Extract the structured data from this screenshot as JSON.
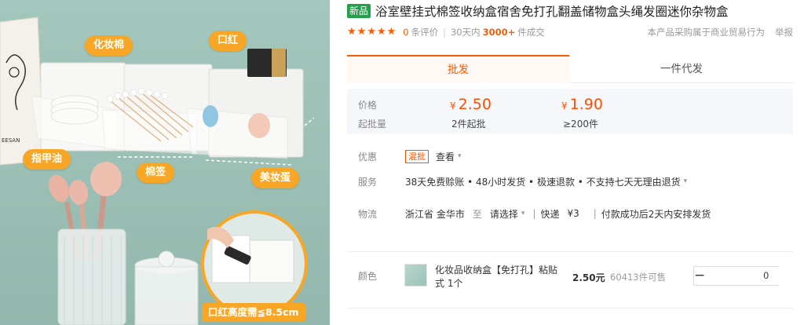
{
  "photo": {
    "tags": {
      "makeup_cotton": "化妆棉",
      "lipstick": "口红",
      "nail_polish": "指甲油",
      "cotton_swab": "棉签",
      "beauty_egg": "美妆蛋"
    },
    "wall_card_text": "EESAN",
    "caption": "口红高度需≦8.5cm"
  },
  "product": {
    "new_badge": "新品",
    "title": "浴室壁挂式棉签收纳盒宿舍免打孔翻盖储物盒头绳发圈迷你杂物盒",
    "rating_stars": 5,
    "review_count": "0",
    "review_suffix": "条评价",
    "sold_prefix": "30天内",
    "sold_count": "3000+",
    "sold_suffix": "件成交",
    "procurement_note": "本产品采购属于商业贸易行为",
    "report_label": "举报"
  },
  "tabs": [
    {
      "label": "批发",
      "active": true
    },
    {
      "label": "一件代发",
      "active": false
    }
  ],
  "pricing": {
    "price_label": "价格",
    "moq_label": "起批量",
    "currency": "¥",
    "tiers": [
      {
        "price": "2.50",
        "moq": "2件起批"
      },
      {
        "price": "1.90",
        "moq": "≥200件"
      }
    ]
  },
  "promo": {
    "label": "优惠",
    "badge": "混批",
    "link": "查看"
  },
  "service": {
    "label": "服务",
    "text": "38天免费赊账 • 48小时发货 • 极速退款 • 不支持七天无理由退货"
  },
  "logistics": {
    "label": "物流",
    "origin": "浙江省 金华市",
    "to": "至",
    "destination": "请选择",
    "express": "快递",
    "fee": "¥3",
    "dispatch": "付款成功后2天内安排发货"
  },
  "sku": {
    "label": "颜色",
    "name": "化妆品收纳盒【免打孔】粘贴式 1个",
    "price": "2.50元",
    "stock": "60413件可售",
    "quantity": "0",
    "minus": "−",
    "plus": "+"
  },
  "colors": {
    "accent": "#ff5000",
    "new_badge": "#21a24a",
    "tag": "#f7a626",
    "price_box": "#f6f7fa"
  }
}
